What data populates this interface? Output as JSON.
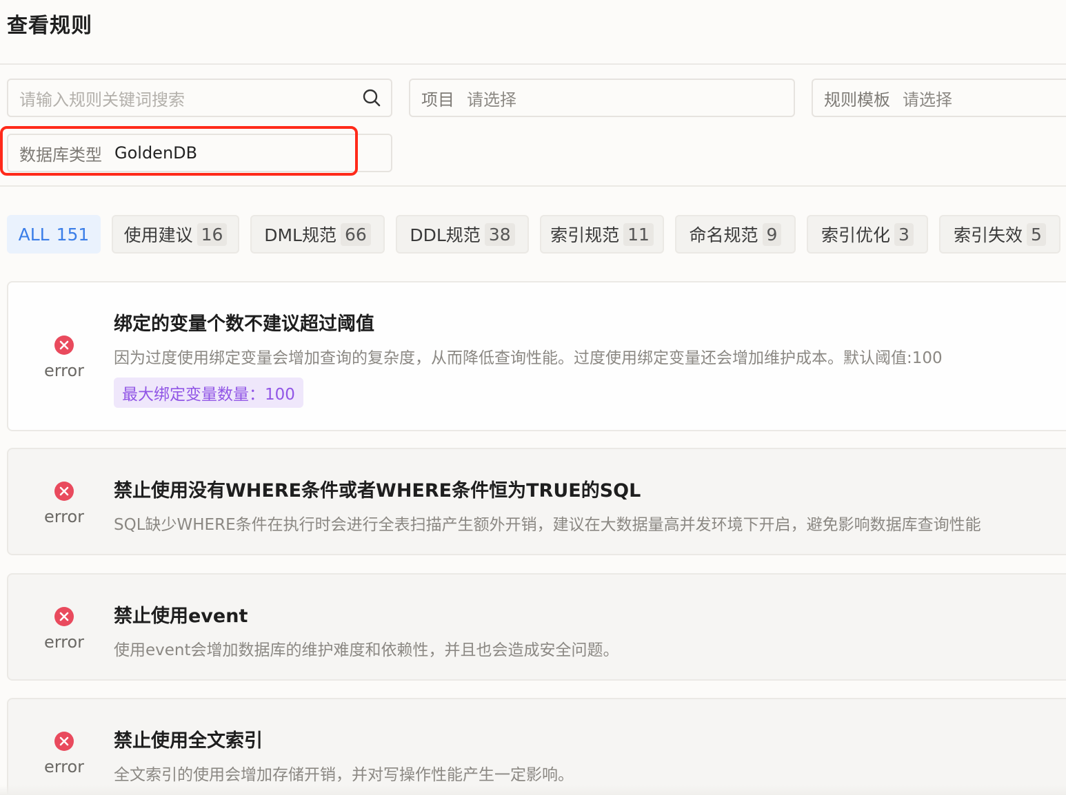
{
  "page": {
    "title": "查看规则"
  },
  "filters": {
    "search_placeholder": "请输入规则关键词搜索",
    "project_label": "项目",
    "project_value": "请选择",
    "template_label": "规则模板",
    "template_value": "请选择",
    "dbtype_label": "数据库类型",
    "dbtype_value": "GoldenDB"
  },
  "tabs": [
    {
      "label": "ALL",
      "count": "151",
      "active": true
    },
    {
      "label": "使用建议",
      "count": "16"
    },
    {
      "label": "DML规范",
      "count": "66"
    },
    {
      "label": "DDL规范",
      "count": "38"
    },
    {
      "label": "索引规范",
      "count": "11"
    },
    {
      "label": "命名规范",
      "count": "9"
    },
    {
      "label": "索引优化",
      "count": "3"
    },
    {
      "label": "索引失效",
      "count": "5"
    }
  ],
  "rules": [
    {
      "level": "error",
      "title": "绑定的变量个数不建议超过阈值",
      "description": "因为过度使用绑定变量会增加查询的复杂度，从而降低查询性能。过度使用绑定变量还会增加维护成本。默认阈值:100",
      "param": "最大绑定变量数量：100"
    },
    {
      "level": "error",
      "title": "禁止使用没有WHERE条件或者WHERE条件恒为TRUE的SQL",
      "description": "SQL缺少WHERE条件在执行时会进行全表扫描产生额外开销，建议在大数据量高并发环境下开启，避免影响数据库查询性能"
    },
    {
      "level": "error",
      "title": "禁止使用event",
      "description": "使用event会增加数据库的维护难度和依赖性，并且也会造成安全问题。"
    },
    {
      "level": "error",
      "title": "禁止使用全文索引",
      "description": "全文索引的使用会增加存储开销，并对写操作性能产生一定影响。"
    }
  ],
  "colors": {
    "accent": "#3b7ee8",
    "error": "#e94a5d",
    "highlight": "#ff2a1a",
    "param_text": "#9156e6",
    "param_bg": "#efe7fb"
  }
}
